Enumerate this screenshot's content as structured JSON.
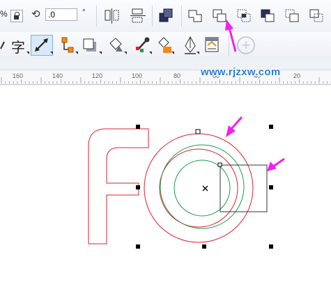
{
  "propertybar": {
    "scale_text": "%",
    "angle_value": ".0",
    "degree_symbol": "°"
  },
  "ruler": {
    "labels": [
      "160",
      "140",
      "120",
      "100",
      "80",
      "60",
      "40",
      "20"
    ]
  },
  "watermark": "www.rjzxw.com",
  "toolbar": {
    "char_glyph": "字",
    "add_label": "+"
  },
  "colors": {
    "outline_red": "#e0202f",
    "outline_green": "#1a9c4a",
    "arrow_magenta": "#ee22ee",
    "accent_blue": "#2a7de1"
  }
}
